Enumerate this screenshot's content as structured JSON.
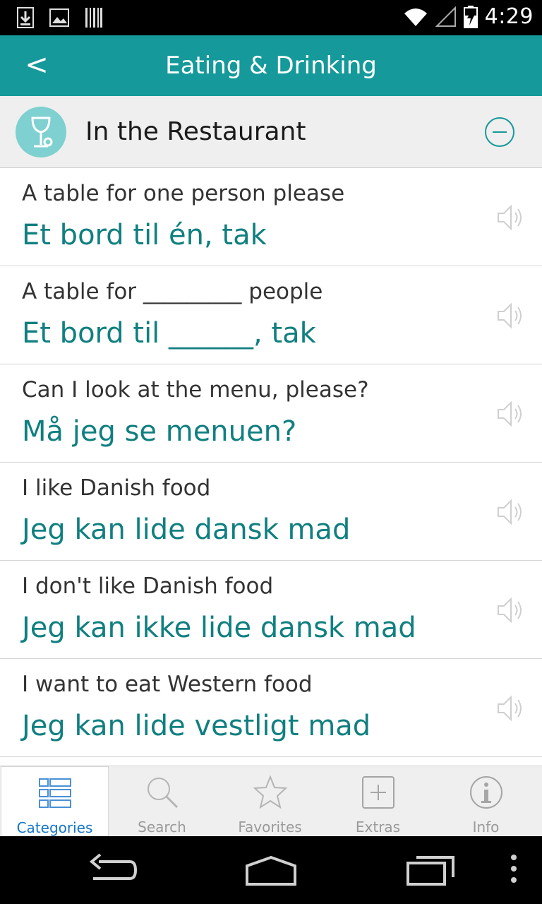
{
  "status_bar": {
    "time": "4:29",
    "icons": [
      "download-icon",
      "image-icon",
      "barcode-icon",
      "wifi-icon",
      "signal-icon",
      "battery-charging-icon"
    ]
  },
  "app_bar": {
    "back_label": "<",
    "title": "Eating & Drinking"
  },
  "section": {
    "title": "In the Restaurant",
    "icon": "wine-glass-icon",
    "collapse_icon": "minus-circle-icon"
  },
  "phrases": [
    {
      "en": "A table for one person please",
      "da": "Et bord til én, tak"
    },
    {
      "en": "A table for _________ people",
      "da": "Et bord til ______, tak"
    },
    {
      "en": "Can I look at the menu, please?",
      "da": "Må jeg se menuen?"
    },
    {
      "en": "I like Danish food",
      "da": "Jeg kan lide dansk mad"
    },
    {
      "en": "I don't like Danish food",
      "da": "Jeg kan ikke lide dansk mad"
    },
    {
      "en": "I want to eat Western food",
      "da": "Jeg kan lide vestligt mad"
    }
  ],
  "tabs": [
    {
      "label": "Categories",
      "icon": "categories-icon",
      "active": true
    },
    {
      "label": "Search",
      "icon": "search-icon",
      "active": false
    },
    {
      "label": "Favorites",
      "icon": "star-icon",
      "active": false
    },
    {
      "label": "Extras",
      "icon": "plus-box-icon",
      "active": false
    },
    {
      "label": "Info",
      "icon": "info-icon",
      "active": false
    }
  ],
  "colors": {
    "app_bar": "#16999a",
    "danish_text": "#107f80",
    "active_tab": "#1676c8"
  }
}
